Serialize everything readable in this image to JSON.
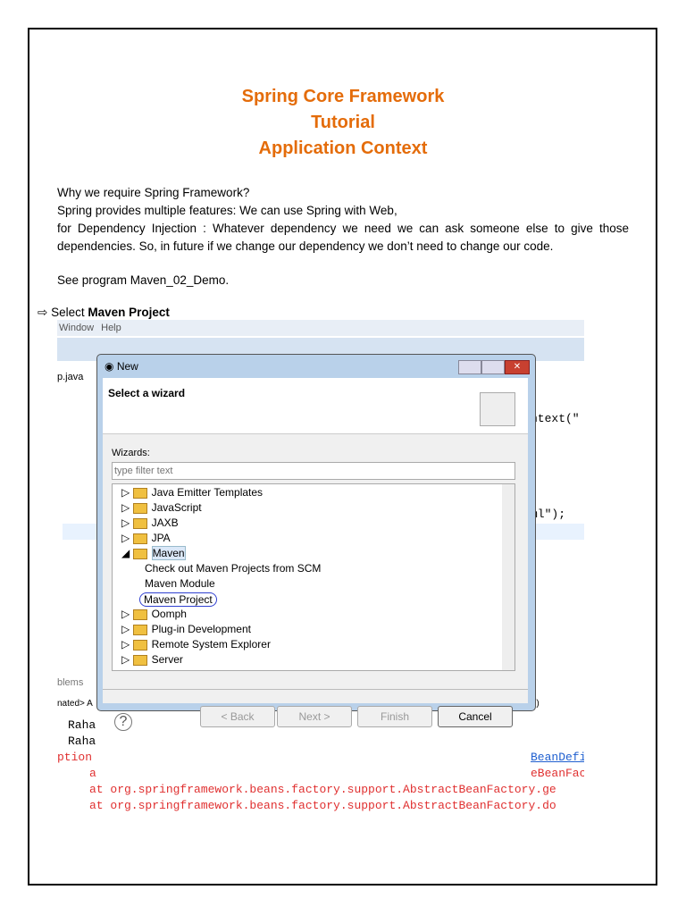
{
  "title": [
    "Spring Core Framework",
    "Tutorial",
    "Application Context"
  ],
  "para": {
    "q": "Why we require Spring Framework?",
    "l1": "Spring provides multiple features: We can use Spring with Web,",
    "l2": "for Dependency Injection : Whatever dependency we need we can ask someone else to give those dependencies. So, in future if we change our dependency we don’t need to change our code.",
    "see": "See program Maven_02_Demo.",
    "select_pre": "Select ",
    "select_bold": "Maven Project"
  },
  "ide": {
    "menu": [
      "Window",
      "Help"
    ],
    "tab": "p.java",
    "code1": "ntext(\"",
    "code2": "ml\");",
    "problems": "blems",
    "terminated": "nated> A",
    "rm": "M)",
    "raha1": "Raha",
    "raha2": "Raha",
    "ption": "ption",
    "link": "BeanDefi",
    "line_a": "a",
    "line_a_end": "eBeanFac",
    "trace1": "at org.springframework.beans.factory.support.AbstractBeanFactory.ge",
    "trace2": "at org.springframework.beans.factory.support.AbstractBeanFactory.do"
  },
  "dialog": {
    "title": "New",
    "heading": "Select a wizard",
    "wizards_label": "Wizards:",
    "filter_placeholder": "type filter text",
    "items": [
      "Java Emitter Templates",
      "JavaScript",
      "JAXB",
      "JPA",
      "Maven",
      "Check out Maven Projects from SCM",
      "Maven Module",
      "Maven Project",
      "Oomph",
      "Plug-in Development",
      "Remote System Explorer",
      "Server"
    ],
    "back": "< Back",
    "next": "Next >",
    "finish": "Finish",
    "cancel": "Cancel"
  }
}
